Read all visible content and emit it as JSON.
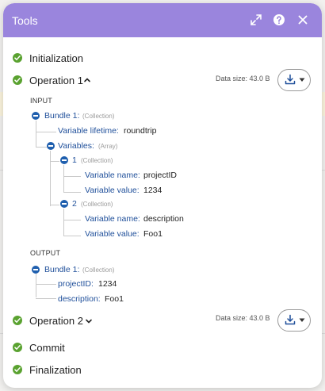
{
  "window": {
    "title": "Tools"
  },
  "header_icons": [
    "expand-icon",
    "help-icon",
    "close-icon"
  ],
  "steps": {
    "initialization": {
      "label": "Initialization"
    },
    "operation1": {
      "label": "Operation 1",
      "data_size": "Data size: 43.0 B",
      "expanded": true
    },
    "operation2": {
      "label": "Operation 2",
      "data_size": "Data size: 43.0 B",
      "expanded": false
    },
    "commit": {
      "label": "Commit"
    },
    "finalization": {
      "label": "Finalization"
    }
  },
  "input": {
    "label": "INPUT",
    "bundle": {
      "key": "Bundle 1:",
      "type": "(Collection)",
      "lifetime_key": "Variable lifetime:",
      "lifetime_val": "roundtrip",
      "variables_key": "Variables:",
      "variables_type": "(Array)",
      "items": [
        {
          "key": "1",
          "type": "(Collection)",
          "name_key": "Variable name:",
          "name_val": "projectID",
          "value_key": "Variable value:",
          "value_val": "1234"
        },
        {
          "key": "2",
          "type": "(Collection)",
          "name_key": "Variable name:",
          "name_val": "description",
          "value_key": "Variable value:",
          "value_val": "Foo1"
        }
      ]
    }
  },
  "output": {
    "label": "OUTPUT",
    "bundle": {
      "key": "Bundle 1:",
      "type": "(Collection)",
      "fields": [
        {
          "key": "projectID:",
          "val": "1234"
        },
        {
          "key": "description:",
          "val": "Foo1"
        }
      ]
    }
  },
  "colors": {
    "header": "#9a85dd",
    "success": "#5aa230",
    "tree_key": "#1f4f9a",
    "toggle": "#1f5fae"
  }
}
